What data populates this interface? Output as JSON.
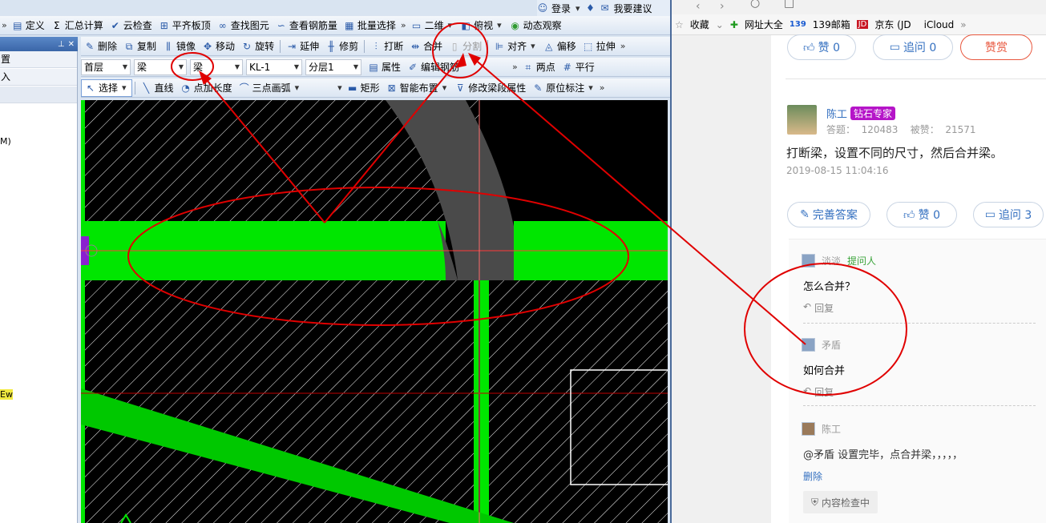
{
  "top_toolbar": {
    "items": [
      "定义",
      "汇总计算",
      "云检查",
      "平齐板顶",
      "查找图元",
      "查看钢筋量",
      "批量选择"
    ],
    "view_2d": "二维",
    "view_top": "俯视",
    "dynamic": "动态观察",
    "login": "登录",
    "suggest": "我要建议"
  },
  "edit_toolbar": {
    "items": [
      "删除",
      "复制",
      "镜像",
      "移动",
      "旋转",
      "延伸",
      "修剪",
      "打断",
      "合并",
      "分割",
      "对齐",
      "偏移",
      "拉伸"
    ]
  },
  "layer_toolbar": {
    "floor": "首层",
    "type": "梁",
    "subtype": "梁",
    "member": "KL-1",
    "sublayer": "分层1",
    "attr": "属性",
    "edit_rebar": "编辑钢筋",
    "two_points": "两点",
    "parallel": "平行"
  },
  "draw_toolbar": {
    "select": "选择",
    "line": "直线",
    "point_length": "点加长度",
    "arc": "三点画弧",
    "rect": "矩形",
    "smart": "智能布置",
    "modify_seg": "修改梁段属性",
    "orig_mark": "原位标注"
  },
  "side_panel": {
    "rows": [
      "置",
      "入"
    ],
    "labels": [
      "M)",
      "Ew"
    ]
  },
  "bookmarks": {
    "items": [
      "收藏",
      "网址大全",
      "139邮箱",
      "京东 (JD",
      "iCloud"
    ]
  },
  "answer_actions": {
    "like": "赞 0",
    "ask": "追问 0",
    "reward": "赞赏"
  },
  "answerer": {
    "name": "陈工",
    "badge": "钻石专家",
    "stats": "答题：  120483    被赞：  21571",
    "answer": "打断梁，设置不同的尺寸，然后合并梁。",
    "time": "2019-08-15 11:04:16",
    "improve": "完善答案",
    "like": "赞 0",
    "ask": "追问 3"
  },
  "comments": [
    {
      "user": "淡淡",
      "tag": "提问人",
      "text": "怎么合并？",
      "reply": "回复"
    },
    {
      "user": "矛盾",
      "tag": "",
      "text": "如何合并",
      "reply": "回复"
    },
    {
      "user": "陈工",
      "tag": "",
      "text": "@矛盾 设置完毕，点合并梁，，，，，",
      "reply": "删除"
    }
  ],
  "review_badge": "内容检查中",
  "colors": {
    "beam_green": "#00e600",
    "annotation_red": "#e00000",
    "canvas_bg": "#000000",
    "link_blue": "#3470c0",
    "badge_purple": "#b515c8"
  }
}
